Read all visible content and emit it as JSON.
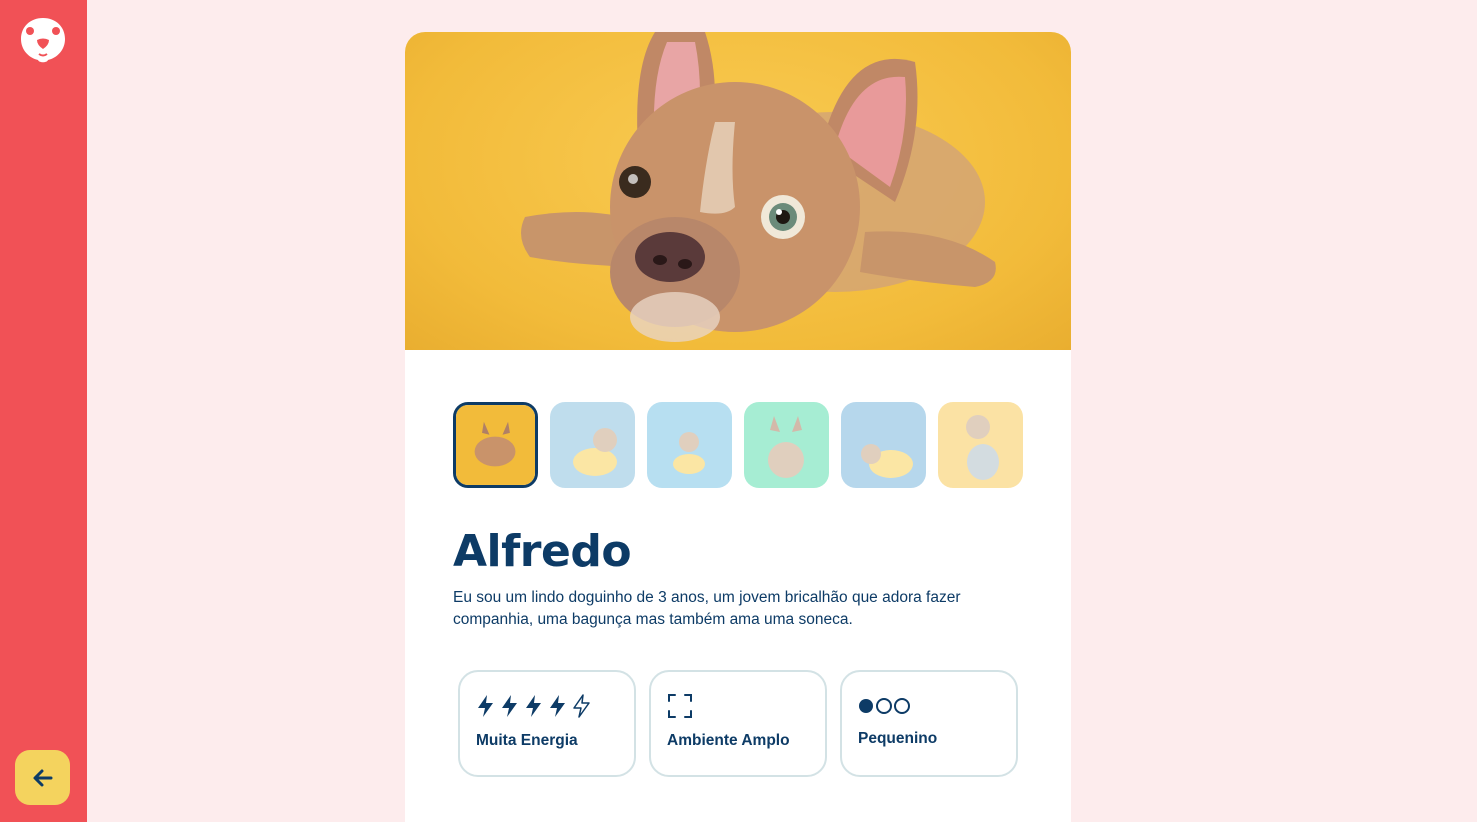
{
  "sidebar": {
    "logo_icon": "dog-face-logo",
    "back_button_icon": "arrow-left-icon",
    "bg_color": "#F15156",
    "back_button_color": "#F4D35E"
  },
  "pet": {
    "name": "Alfredo",
    "description": "Eu sou um lindo doguinho de 3 anos, um jovem bricalhão que adora fazer companhia, uma bagunça mas também ama uma soneca.",
    "photos": [
      {
        "bg": "#F2BB3A",
        "active": true
      },
      {
        "bg": "#BFE0EC",
        "active": false
      },
      {
        "bg": "#A9D8EA",
        "active": false
      },
      {
        "bg": "#7EE6C3",
        "active": false
      },
      {
        "bg": "#A9D0E6",
        "active": false
      },
      {
        "bg": "#FBE3A5",
        "active": false
      }
    ]
  },
  "features": {
    "energy": {
      "label": "Muita Energia",
      "level": 4,
      "max": 5,
      "icon": "lightning-icon"
    },
    "environment": {
      "label": "Ambiente Amplo",
      "icon": "expand-icon"
    },
    "size": {
      "label": "Pequenino",
      "level": 1,
      "max": 3,
      "icon": "circle-icon"
    }
  },
  "colors": {
    "page_bg": "#FDECED",
    "primary_text": "#0D3B66",
    "card_border": "#D3E2E5"
  }
}
